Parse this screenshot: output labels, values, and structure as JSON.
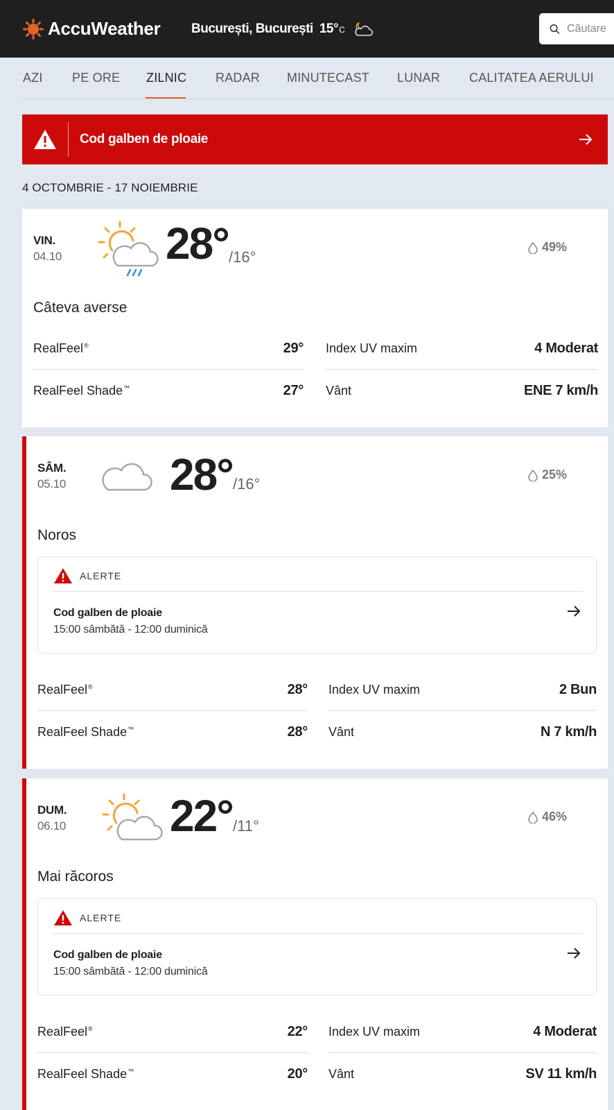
{
  "header": {
    "brand": "AccuWeather",
    "location": "București, București",
    "temp": "15°",
    "unit": "C",
    "search_placeholder": "Căutare"
  },
  "tabs": [
    {
      "label": "AZI",
      "active": false
    },
    {
      "label": "PE ORE",
      "active": false
    },
    {
      "label": "ZILNIC",
      "active": true
    },
    {
      "label": "RADAR",
      "active": false
    },
    {
      "label": "MINUTECAST",
      "active": false
    },
    {
      "label": "LUNAR",
      "active": false
    },
    {
      "label": "CALITATEA AERULUI",
      "active": false
    }
  ],
  "banner": {
    "text": "Cod galben de ploaie"
  },
  "date_range": "4 OCTOMBRIE - 17 NOIEMBRIE",
  "days": [
    {
      "dow": "VIN.",
      "date": "04.10",
      "icon": "sun-cloud-rain-icon",
      "high": "28°",
      "low": "/16°",
      "precip": "49%",
      "phrase": "Câteva averse",
      "realfeel_label": "RealFeel",
      "realfeel_mark": "®",
      "realfeel": "29°",
      "shade_label": "RealFeel Shade",
      "shade_mark": "™",
      "shade": "27°",
      "uv_label": "Index UV maxim",
      "uv": "4 Moderat",
      "wind_label": "Vânt",
      "wind": "ENE 7 km/h"
    },
    {
      "dow": "SÂM.",
      "date": "05.10",
      "icon": "cloud-icon",
      "high": "28°",
      "low": "/16°",
      "precip": "25%",
      "phrase": "Noros",
      "alert": {
        "heading": "ALERTE",
        "title": "Cod galben de ploaie",
        "time": "15:00 sâmbătă - 12:00 duminică"
      },
      "realfeel_label": "RealFeel",
      "realfeel_mark": "®",
      "realfeel": "28°",
      "shade_label": "RealFeel Shade",
      "shade_mark": "™",
      "shade": "28°",
      "uv_label": "Index UV maxim",
      "uv": "2 Bun",
      "wind_label": "Vânt",
      "wind": "N 7 km/h"
    },
    {
      "dow": "DUM.",
      "date": "06.10",
      "icon": "sun-cloud-icon",
      "high": "22°",
      "low": "/11°",
      "precip": "46%",
      "phrase": "Mai răcoros",
      "alert": {
        "heading": "ALERTE",
        "title": "Cod galben de ploaie",
        "time": "15:00 sâmbătă - 12:00 duminică"
      },
      "realfeel_label": "RealFeel",
      "realfeel_mark": "®",
      "realfeel": "22°",
      "shade_label": "RealFeel Shade",
      "shade_mark": "™",
      "shade": "20°",
      "uv_label": "Index UV maxim",
      "uv": "4 Moderat",
      "wind_label": "Vânt",
      "wind": "SV 11 km/h"
    }
  ],
  "colors": {
    "accent": "#e6642b",
    "alert_red": "#cc0a0a",
    "header_bg": "#1f1f1f",
    "page_bg": "#e1e8f0"
  }
}
